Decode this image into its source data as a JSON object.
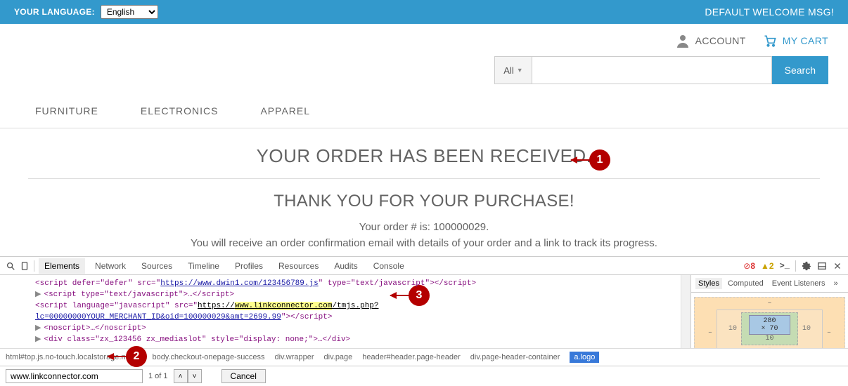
{
  "topbar": {
    "lang_label": "YOUR LANGUAGE:",
    "lang_value": "English",
    "welcome": "DEFAULT WELCOME MSG!"
  },
  "header": {
    "account": "ACCOUNT",
    "cart": "MY CART"
  },
  "search": {
    "all_label": "All",
    "button": "Search"
  },
  "nav": {
    "items": [
      "FURNITURE",
      "ELECTRONICS",
      "APPAREL"
    ]
  },
  "main": {
    "title": "YOUR ORDER HAS BEEN RECEIVED.",
    "subtitle": "THANK YOU FOR YOUR PURCHASE!",
    "order_line": "Your order # is: 100000029.",
    "info_line": "You will receive an order confirmation email with details of your order and a link to track its progress."
  },
  "annotations": {
    "n1": "1",
    "n2": "2",
    "n3": "3"
  },
  "devtools": {
    "tabs": [
      "Elements",
      "Network",
      "Sources",
      "Timeline",
      "Profiles",
      "Resources",
      "Audits",
      "Console"
    ],
    "active_tab": "Elements",
    "errors": "8",
    "warnings": "2",
    "lines": {
      "l1_pre": "<script defer=\"defer\" src=\"",
      "l1_url": "https://www.dwin1.com/123456789.js",
      "l1_post_attr": "\" type=\"text/javascript\">",
      "l1_close": "</script>",
      "l2": "<script type=\"text/javascript\">…</script>",
      "l3_pre": "<script language=\"javascript\" src=\"",
      "l3_u1": "https://",
      "l3_u2": "www.linkconnector.com",
      "l3_u3": "/tmjs.php?",
      "l4_url": "lc=00000000YOUR_MERCHANT_ID&oid=100000029&amt=2699.99",
      "l4_post": "\">",
      "l4_close": "</script>",
      "l5": "<noscript>…</noscript>",
      "l6": "<div class=\"zx_123456 zx_mediaslot\" style=\"display: none;\">…</div>"
    },
    "sidebar_tabs": [
      "Styles",
      "Computed",
      "Event Listeners"
    ],
    "box_model": {
      "content": "280 × 70",
      "padding": "10",
      "side": "10",
      "dash": "–"
    },
    "breadcrumbs": [
      "html#top.js.no-touch.localstorage.no-ios",
      "body.checkout-onepage-success",
      "div.wrapper",
      "div.page",
      "header#header.page-header",
      "div.page-header-container",
      "a.logo"
    ],
    "find": {
      "value": "www.linkconnector.com",
      "results": "1 of 1",
      "cancel": "Cancel"
    }
  }
}
